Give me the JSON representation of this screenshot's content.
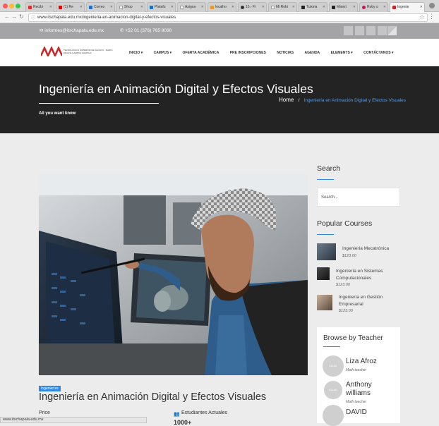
{
  "browser": {
    "tabs": [
      {
        "label": "Recibi"
      },
      {
        "label": "(1) Re"
      },
      {
        "label": "Correo"
      },
      {
        "label": "Shop"
      },
      {
        "label": "Platafo"
      },
      {
        "label": "Asigna"
      },
      {
        "label": "localho"
      },
      {
        "label": "15.- Fi"
      },
      {
        "label": "Mi Robi"
      },
      {
        "label": "Tutoria"
      },
      {
        "label": "Materi"
      },
      {
        "label": "Ruby o"
      },
      {
        "label": "Ingenie"
      }
    ],
    "url": "www.itschapala.edu.mx/ingenieria-en-animacion-digital-y-efectos-visuales",
    "status_url": "www.itschapala.edu.mx"
  },
  "topbar": {
    "email": "informes@itschapala.edu.mx",
    "phone": "+52 01 (376) 765 8030"
  },
  "header": {
    "logo_text": "TECNOLÓGICO SUPERIOR DE JALISCO · MARIO MOLINA CAMPUS CHAPALA",
    "nav": [
      "INICIO ▾",
      "CAMPUS ▾",
      "OFERTA ACADÉMICA",
      "PRE INSCRIPCIONES",
      "NOTICIAS",
      "AGENDA",
      "ELEMENTS ▾",
      "CONTÁCTANOS ▾"
    ]
  },
  "banner": {
    "title": "Ingeniería en Animación Digital y Efectos Visuales",
    "subtitle": "All you want know",
    "breadcrumb_home": "Home",
    "breadcrumb_sep": "/",
    "breadcrumb_current": "Ingeniería en Animación Digital y Efectos Visuales"
  },
  "course": {
    "badge": "Ingenierías",
    "title": "Ingeniería en Animación Digital y Efectos Visuales",
    "price_label": "Price",
    "students_label": "Estudiantes Actuales",
    "students_value": "1000+"
  },
  "sidebar": {
    "search_heading": "Search",
    "search_placeholder": "Search...",
    "popular_heading": "Popular Courses",
    "popular": [
      {
        "name": "Ingeniería Mecatrónica",
        "price": "$123.00"
      },
      {
        "name": "Ingeniería en Sistemas Computacionales",
        "price": "$123.00"
      },
      {
        "name": "Ingeniería en Gestión Empresarial",
        "price": "$123.00"
      }
    ],
    "teacher_heading": "Browse by Teacher",
    "teachers": [
      {
        "name": "Liza Afroz",
        "role": "Math teacher",
        "avatar_label": "ELLAS"
      },
      {
        "name": "Anthony williams",
        "role": "Math teacher",
        "avatar_label": "ELLAS"
      },
      {
        "name": "DAVID",
        "role": "",
        "avatar_label": ""
      }
    ]
  }
}
